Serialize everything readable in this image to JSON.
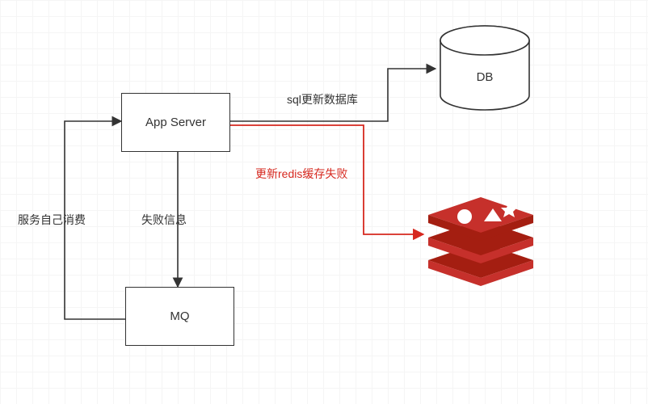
{
  "nodes": {
    "app_server": {
      "label": "App Server"
    },
    "mq": {
      "label": "MQ"
    },
    "db": {
      "label": "DB"
    }
  },
  "edges": {
    "to_db": {
      "label": "sql更新数据库"
    },
    "to_redis": {
      "label": "更新redis缓存失败"
    },
    "to_mq": {
      "label": "失败信息"
    },
    "mq_back": {
      "label": "服务自己消费"
    }
  },
  "colors": {
    "stroke": "#333333",
    "fail": "#d6281f",
    "redis": "#c6302b",
    "redis_dark": "#a41e11"
  }
}
